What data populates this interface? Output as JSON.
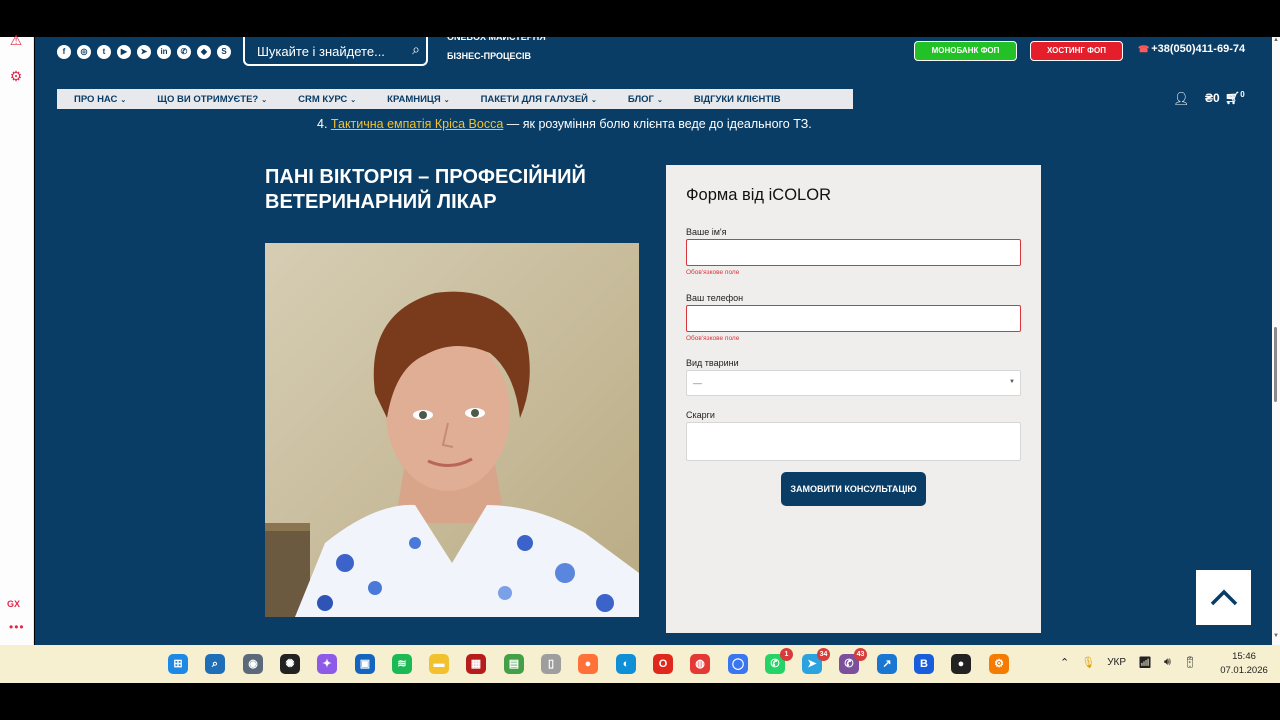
{
  "header": {
    "social_icons": [
      "facebook-icon",
      "instagram-icon",
      "twitter-icon",
      "youtube-icon",
      "telegram-icon",
      "linkedin-icon",
      "whatsapp-icon",
      "android-icon",
      "skype-icon"
    ],
    "search_placeholder": "Шукайте і знайдете...",
    "tagline_line1": "ONEBOX МАЙСТЕРНЯ",
    "tagline_line2": "БІЗНЕС-ПРОЦЕСІВ",
    "btn_monobank": "МОНОБАНК ФОП",
    "btn_hosting": "ХОСТИНГ ФОП",
    "phone": "+38(050)411-69-74",
    "cart_amount": "₴0",
    "cart_count": "0"
  },
  "nav": {
    "items": [
      {
        "label": "ПРО НАС",
        "has_dropdown": true
      },
      {
        "label": "ЩО ВИ ОТРИМУЄТЕ?",
        "has_dropdown": true
      },
      {
        "label": "CRM КУРС",
        "has_dropdown": true
      },
      {
        "label": "КРАМНИЦЯ",
        "has_dropdown": true
      },
      {
        "label": "ПАКЕТИ ДЛЯ ГАЛУЗЕЙ",
        "has_dropdown": true
      },
      {
        "label": "БЛОГ",
        "has_dropdown": true
      },
      {
        "label": "ВІДГУКИ КЛІЄНТІВ",
        "has_dropdown": false
      }
    ]
  },
  "content": {
    "list_number": "4.",
    "list_link": "Тактична емпатія Кріса Восса",
    "list_rest": " — як розуміння болю клієнта веде до ідеального ТЗ.",
    "heading": "ПАНІ ВІКТОРІЯ – ПРОФЕСІЙНИЙ ВЕТЕРИНАРНИЙ ЛІКАР"
  },
  "form": {
    "title": "Форма від iCOLOR",
    "name_label": "Ваше ім'я",
    "name_value": "",
    "name_error": "Обов'язкове поле",
    "phone_label": "Ваш телефон",
    "phone_value": "",
    "phone_error": "Обов'язкове поле",
    "animal_label": "Вид тварини",
    "animal_selected": "—",
    "complaints_label": "Скарги",
    "submit_label": "ЗАМОВИТИ КОНСУЛЬТАЦІЮ"
  },
  "taskbar": {
    "apps": [
      {
        "name": "windows-start-icon",
        "color": "#1e88e5",
        "badge": ""
      },
      {
        "name": "search-icon",
        "color": "#1e6fb8",
        "badge": ""
      },
      {
        "name": "camera-icon",
        "color": "#5a6a7a",
        "badge": ""
      },
      {
        "name": "chatgpt-icon",
        "color": "#222222",
        "badge": ""
      },
      {
        "name": "copilot-icon",
        "color": "#8e5be8",
        "badge": ""
      },
      {
        "name": "store-icon",
        "color": "#1565c0",
        "badge": ""
      },
      {
        "name": "spotify-icon",
        "color": "#1db954",
        "badge": ""
      },
      {
        "name": "folder-icon",
        "color": "#f2c12e",
        "badge": ""
      },
      {
        "name": "app-red-icon",
        "color": "#b71c1c",
        "badge": ""
      },
      {
        "name": "chart-app-icon",
        "color": "#43a047",
        "badge": ""
      },
      {
        "name": "document-icon",
        "color": "#9e9e9e",
        "badge": ""
      },
      {
        "name": "firefox-icon",
        "color": "#ff7139",
        "badge": ""
      },
      {
        "name": "edge-icon",
        "color": "#0f8fd6",
        "badge": ""
      },
      {
        "name": "opera-icon",
        "color": "#e0281d",
        "badge": ""
      },
      {
        "name": "chrome-icon",
        "color": "#e53935",
        "badge": ""
      },
      {
        "name": "signal-icon",
        "color": "#3a76f0",
        "badge": ""
      },
      {
        "name": "whatsapp-icon",
        "color": "#25d366",
        "badge": "1"
      },
      {
        "name": "telegram-icon",
        "color": "#2aa3df",
        "badge": "34"
      },
      {
        "name": "viber-icon",
        "color": "#7b519d",
        "badge": "43"
      },
      {
        "name": "arrow-app-icon",
        "color": "#1976d2",
        "badge": ""
      },
      {
        "name": "bitwarden-icon",
        "color": "#175ddc",
        "badge": ""
      },
      {
        "name": "record-icon",
        "color": "#222222",
        "badge": ""
      },
      {
        "name": "settings-app-icon",
        "color": "#f57c00",
        "badge": ""
      }
    ],
    "tray_lang": "УКР",
    "time": "15:46",
    "date": "07.01.2026"
  }
}
